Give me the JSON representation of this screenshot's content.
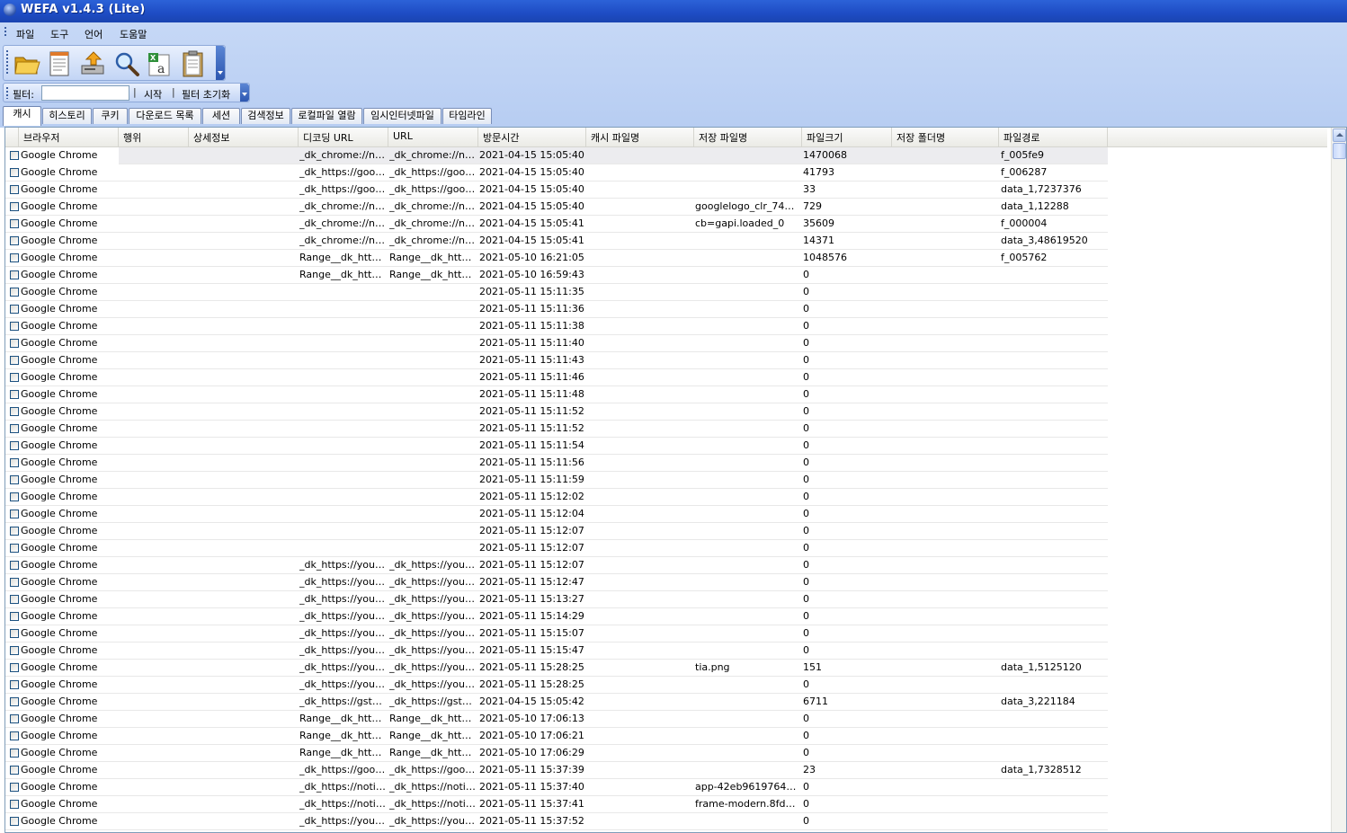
{
  "window": {
    "title": "WEFA v1.4.3 (Lite)"
  },
  "menu": [
    "파일",
    "도구",
    "언어",
    "도움말"
  ],
  "toolbar": {
    "icons": [
      "open-folder-icon",
      "report-icon",
      "export-icon",
      "search-icon",
      "excel-export-icon",
      "clipboard-icon"
    ]
  },
  "filter": {
    "label": "필터:",
    "value": "",
    "start_label": "시작",
    "reset_label": "필터 초기화"
  },
  "tabs": [
    "캐시",
    "히스토리",
    "쿠키",
    "다운로드 목록",
    "세션",
    "검색정보",
    "로컬파일 열람",
    "임시인터넷파일",
    "타임라인"
  ],
  "active_tab": "캐시",
  "columns": [
    "브라우저",
    "행위",
    "상세정보",
    "디코딩 URL",
    "URL",
    "방문시간",
    "캐시 파일명",
    "저장 파일명",
    "파일크기",
    "저장 폴더명",
    "파일경로"
  ],
  "rows": [
    [
      "Google Chrome",
      "",
      "",
      "_dk_chrome://ne...",
      "_dk_chrome://ne...",
      "2021-04-15 15:05:40",
      "",
      "",
      "1470068",
      "",
      "f_005fe9"
    ],
    [
      "Google Chrome",
      "",
      "",
      "_dk_https://goog...",
      "_dk_https://goog...",
      "2021-04-15 15:05:40",
      "",
      "",
      "41793",
      "",
      "f_006287"
    ],
    [
      "Google Chrome",
      "",
      "",
      "_dk_https://goog...",
      "_dk_https://goog...",
      "2021-04-15 15:05:40",
      "",
      "",
      "33",
      "",
      "data_1,7237376"
    ],
    [
      "Google Chrome",
      "",
      "",
      "_dk_chrome://ne...",
      "_dk_chrome://ne...",
      "2021-04-15 15:05:40",
      "",
      "googlelogo_clr_74x2...",
      "729",
      "",
      "data_1,12288"
    ],
    [
      "Google Chrome",
      "",
      "",
      "_dk_chrome://ne...",
      "_dk_chrome://ne...",
      "2021-04-15 15:05:41",
      "",
      "cb=gapi.loaded_0",
      "35609",
      "",
      "f_000004"
    ],
    [
      "Google Chrome",
      "",
      "",
      "_dk_chrome://ne...",
      "_dk_chrome://ne...",
      "2021-04-15 15:05:41",
      "",
      "",
      "14371",
      "",
      "data_3,48619520"
    ],
    [
      "Google Chrome",
      "",
      "",
      "Range__dk_http...",
      "Range__dk_http...",
      "2021-05-10 16:21:05",
      "",
      "",
      "1048576",
      "",
      "f_005762"
    ],
    [
      "Google Chrome",
      "",
      "",
      "Range__dk_http...",
      "Range__dk_http...",
      "2021-05-10 16:59:43",
      "",
      "",
      "0",
      "",
      ""
    ],
    [
      "Google Chrome",
      "",
      "",
      "",
      "",
      "2021-05-11 15:11:35",
      "",
      "",
      "0",
      "",
      ""
    ],
    [
      "Google Chrome",
      "",
      "",
      "",
      "",
      "2021-05-11 15:11:36",
      "",
      "",
      "0",
      "",
      ""
    ],
    [
      "Google Chrome",
      "",
      "",
      "",
      "",
      "2021-05-11 15:11:38",
      "",
      "",
      "0",
      "",
      ""
    ],
    [
      "Google Chrome",
      "",
      "",
      "",
      "",
      "2021-05-11 15:11:40",
      "",
      "",
      "0",
      "",
      ""
    ],
    [
      "Google Chrome",
      "",
      "",
      "",
      "",
      "2021-05-11 15:11:43",
      "",
      "",
      "0",
      "",
      ""
    ],
    [
      "Google Chrome",
      "",
      "",
      "",
      "",
      "2021-05-11 15:11:46",
      "",
      "",
      "0",
      "",
      ""
    ],
    [
      "Google Chrome",
      "",
      "",
      "",
      "",
      "2021-05-11 15:11:48",
      "",
      "",
      "0",
      "",
      ""
    ],
    [
      "Google Chrome",
      "",
      "",
      "",
      "",
      "2021-05-11 15:11:52",
      "",
      "",
      "0",
      "",
      ""
    ],
    [
      "Google Chrome",
      "",
      "",
      "",
      "",
      "2021-05-11 15:11:52",
      "",
      "",
      "0",
      "",
      ""
    ],
    [
      "Google Chrome",
      "",
      "",
      "",
      "",
      "2021-05-11 15:11:54",
      "",
      "",
      "0",
      "",
      ""
    ],
    [
      "Google Chrome",
      "",
      "",
      "",
      "",
      "2021-05-11 15:11:56",
      "",
      "",
      "0",
      "",
      ""
    ],
    [
      "Google Chrome",
      "",
      "",
      "",
      "",
      "2021-05-11 15:11:59",
      "",
      "",
      "0",
      "",
      ""
    ],
    [
      "Google Chrome",
      "",
      "",
      "",
      "",
      "2021-05-11 15:12:02",
      "",
      "",
      "0",
      "",
      ""
    ],
    [
      "Google Chrome",
      "",
      "",
      "",
      "",
      "2021-05-11 15:12:04",
      "",
      "",
      "0",
      "",
      ""
    ],
    [
      "Google Chrome",
      "",
      "",
      "",
      "",
      "2021-05-11 15:12:07",
      "",
      "",
      "0",
      "",
      ""
    ],
    [
      "Google Chrome",
      "",
      "",
      "",
      "",
      "2021-05-11 15:12:07",
      "",
      "",
      "0",
      "",
      ""
    ],
    [
      "Google Chrome",
      "",
      "",
      "_dk_https://yout...",
      "_dk_https://yout...",
      "2021-05-11 15:12:07",
      "",
      "",
      "0",
      "",
      ""
    ],
    [
      "Google Chrome",
      "",
      "",
      "_dk_https://yout...",
      "_dk_https://yout...",
      "2021-05-11 15:12:47",
      "",
      "",
      "0",
      "",
      ""
    ],
    [
      "Google Chrome",
      "",
      "",
      "_dk_https://yout...",
      "_dk_https://yout...",
      "2021-05-11 15:13:27",
      "",
      "",
      "0",
      "",
      ""
    ],
    [
      "Google Chrome",
      "",
      "",
      "_dk_https://yout...",
      "_dk_https://yout...",
      "2021-05-11 15:14:29",
      "",
      "",
      "0",
      "",
      ""
    ],
    [
      "Google Chrome",
      "",
      "",
      "_dk_https://yout...",
      "_dk_https://yout...",
      "2021-05-11 15:15:07",
      "",
      "",
      "0",
      "",
      ""
    ],
    [
      "Google Chrome",
      "",
      "",
      "_dk_https://yout...",
      "_dk_https://yout...",
      "2021-05-11 15:15:47",
      "",
      "",
      "0",
      "",
      ""
    ],
    [
      "Google Chrome",
      "",
      "",
      "_dk_https://yout...",
      "_dk_https://yout...",
      "2021-05-11 15:28:25",
      "",
      "tia.png",
      "151",
      "",
      "data_1,5125120"
    ],
    [
      "Google Chrome",
      "",
      "",
      "_dk_https://yout...",
      "_dk_https://yout...",
      "2021-05-11 15:28:25",
      "",
      "",
      "0",
      "",
      ""
    ],
    [
      "Google Chrome",
      "",
      "",
      "_dk_https://gsta...",
      "_dk_https://gsta...",
      "2021-04-15 15:05:42",
      "",
      "",
      "6711",
      "",
      "data_3,221184"
    ],
    [
      "Google Chrome",
      "",
      "",
      "Range__dk_http...",
      "Range__dk_http...",
      "2021-05-10 17:06:13",
      "",
      "",
      "0",
      "",
      ""
    ],
    [
      "Google Chrome",
      "",
      "",
      "Range__dk_http...",
      "Range__dk_http...",
      "2021-05-10 17:06:21",
      "",
      "",
      "0",
      "",
      ""
    ],
    [
      "Google Chrome",
      "",
      "",
      "Range__dk_http...",
      "Range__dk_http...",
      "2021-05-10 17:06:29",
      "",
      "",
      "0",
      "",
      ""
    ],
    [
      "Google Chrome",
      "",
      "",
      "_dk_https://goog...",
      "_dk_https://goog...",
      "2021-05-11 15:37:39",
      "",
      "",
      "23",
      "",
      "data_1,7328512"
    ],
    [
      "Google Chrome",
      "",
      "",
      "_dk_https://notio...",
      "_dk_https://notio...",
      "2021-05-11 15:37:40",
      "",
      "app-42eb9619764b8...",
      "0",
      "",
      ""
    ],
    [
      "Google Chrome",
      "",
      "",
      "_dk_https://notio...",
      "_dk_https://notio...",
      "2021-05-11 15:37:41",
      "",
      "frame-modern.8fd0d...",
      "0",
      "",
      ""
    ],
    [
      "Google Chrome",
      "",
      "",
      "_dk_https://yout...",
      "_dk_https://yout...",
      "2021-05-11 15:37:52",
      "",
      "",
      "0",
      "",
      ""
    ]
  ],
  "selected_row": 0
}
